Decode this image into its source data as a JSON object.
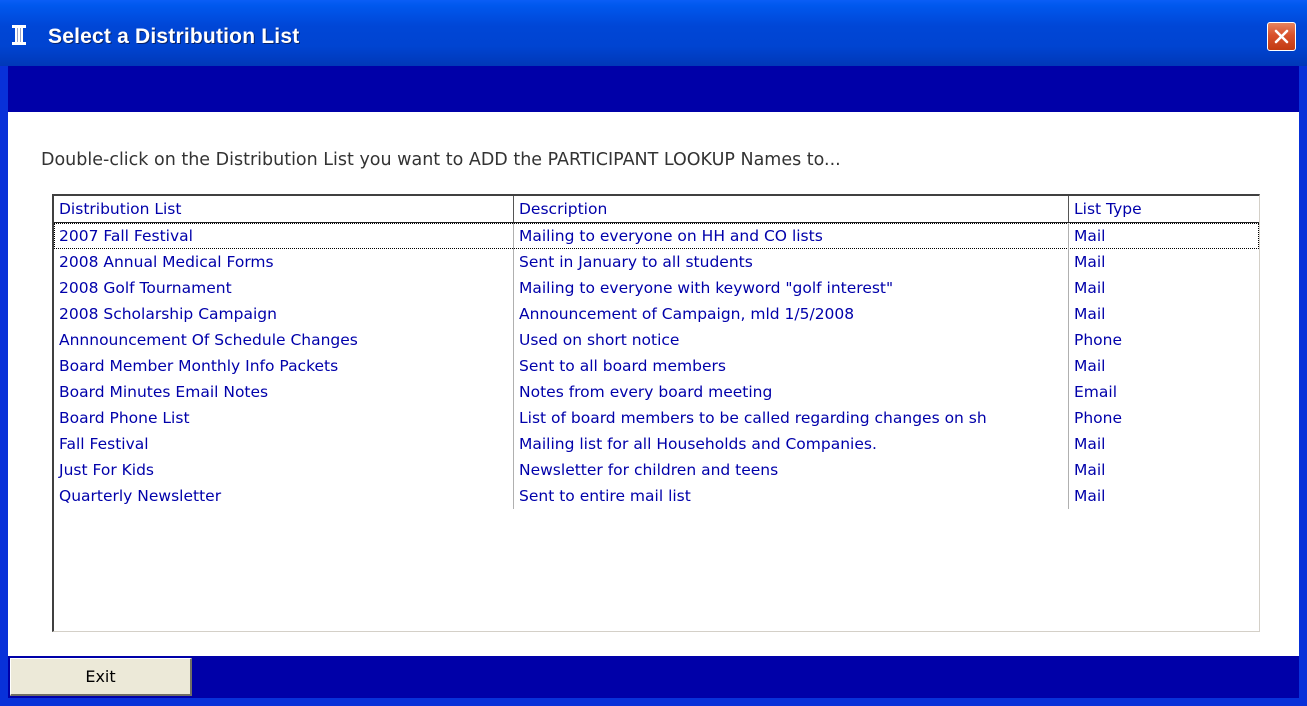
{
  "window": {
    "title": "Select a Distribution List"
  },
  "instruction": "Double-click on the Distribution List you want to ADD the PARTICIPANT LOOKUP Names to...",
  "list": {
    "columns": [
      "Distribution List",
      "Description",
      "List Type"
    ],
    "rows": [
      {
        "name": "2007 Fall Festival",
        "description": "Mailing to everyone on HH and CO lists",
        "type": "Mail",
        "selected": true
      },
      {
        "name": "2008 Annual Medical Forms",
        "description": "Sent in January to all students",
        "type": "Mail"
      },
      {
        "name": "2008 Golf Tournament",
        "description": "Mailing to everyone with keyword \"golf interest\"",
        "type": "Mail"
      },
      {
        "name": "2008 Scholarship Campaign",
        "description": "Announcement of Campaign, mld 1/5/2008",
        "type": "Mail"
      },
      {
        "name": "Annnouncement Of Schedule Changes",
        "description": "Used on short notice",
        "type": "Phone"
      },
      {
        "name": "Board Member Monthly Info Packets",
        "description": "Sent to all board members",
        "type": "Mail"
      },
      {
        "name": "Board Minutes Email Notes",
        "description": "Notes from every board meeting",
        "type": "Email"
      },
      {
        "name": "Board Phone List",
        "description": "List of board members to be called regarding changes on sh",
        "type": "Phone"
      },
      {
        "name": "Fall Festival",
        "description": "Mailing list for all Households and Companies.",
        "type": "Mail"
      },
      {
        "name": "Just For Kids",
        "description": "Newsletter for children and teens",
        "type": "Mail"
      },
      {
        "name": "Quarterly Newsletter",
        "description": "Sent to entire mail list",
        "type": "Mail"
      }
    ]
  },
  "buttons": {
    "exit": "Exit"
  },
  "colors": {
    "titlebar": "#0046d6",
    "band": "#0000a8",
    "list_text": "#0000aa",
    "close_button": "#d9512c"
  },
  "icons": {
    "app": "column-icon",
    "close": "close-icon"
  }
}
